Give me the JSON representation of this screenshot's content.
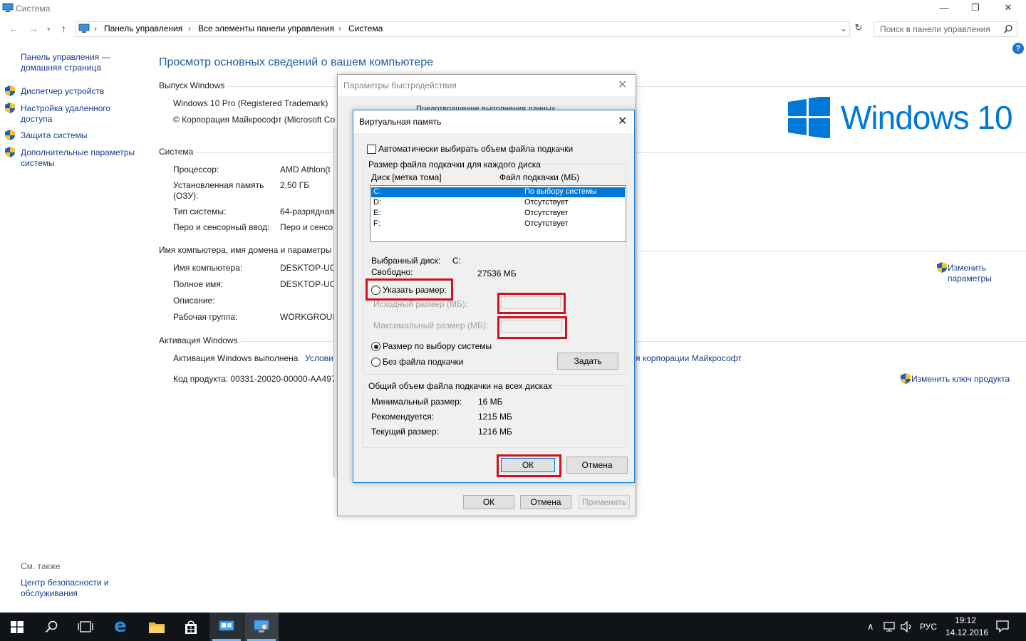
{
  "window": {
    "title": "Система",
    "controls": [
      "—",
      "❐",
      "✕"
    ]
  },
  "address_bar": {
    "crumbs": [
      "Панель управления",
      "Все элементы панели управления",
      "Система"
    ],
    "search_placeholder": "Поиск в панели управления"
  },
  "sidebar": {
    "home": [
      "Панель управления —",
      "домашняя страница"
    ],
    "items": [
      {
        "label": [
          "Диспетчер устройств"
        ]
      },
      {
        "label": [
          "Настройка удаленного",
          "доступа"
        ]
      },
      {
        "label": [
          "Защита системы"
        ]
      },
      {
        "label": [
          "Дополнительные параметры",
          "системы"
        ]
      }
    ],
    "see_also": "См. также",
    "see_also_link": [
      "Центр безопасности и",
      "обслуживания"
    ]
  },
  "main": {
    "heading": "Просмотр основных сведений о вашем компьютере",
    "edition_title": "Выпуск Windows",
    "edition_name": "Windows 10 Pro (Registered Trademark)",
    "copyright": "© Корпорация Майкрософт (Microsoft Co",
    "logo_text": "Windows 10",
    "system_title": "Система",
    "system_rows": [
      {
        "label": "Процессор:",
        "value": "AMD Athlon(t"
      },
      {
        "label": "Установленная память",
        "label2": "(ОЗУ):",
        "value": "2,50 ГБ"
      },
      {
        "label": "Тип системы:",
        "value": "64-разрядная"
      },
      {
        "label": "Перо и сенсорный ввод:",
        "value": "Перо и сенсо"
      }
    ],
    "computer_title": "Имя компьютера, имя домена и параметры",
    "computer_rows": [
      {
        "label": "Имя компьютера:",
        "value": "DESKTOP-UC7"
      },
      {
        "label": "Полное имя:",
        "value": "DESKTOP-UC7"
      },
      {
        "label": "Описание:",
        "value": ""
      },
      {
        "label": "Рабочая группа:",
        "value": "WORKGROUP"
      }
    ],
    "change_params": [
      "Изменить",
      "параметры"
    ],
    "activation_title": "Активация Windows",
    "activation_status": "Активация Windows выполнена",
    "activation_terms": "Услови",
    "activation_terms_tail": "я корпорации Майкрософт",
    "product_code": "Код продукта:  00331-20020-00000-AA497",
    "change_key": "Изменить ключ продукта"
  },
  "perf_dialog": {
    "title": "Параметры быстродействия",
    "tab_hint": "Предотвращение выполнения данных",
    "ok": "ОК",
    "cancel": "Отмена",
    "apply": "Применить"
  },
  "vm_dialog": {
    "title": "Виртуальная память",
    "auto_label": "Автоматически выбирать объем файла подкачки",
    "auto_checked": false,
    "group_title": "Размер файла подкачки для каждого диска",
    "col_disk": "Диск [метка тома]",
    "col_file": "Файл подкачки (МБ)",
    "drives": [
      {
        "disk": "C:",
        "size": "По выбору системы",
        "selected": true
      },
      {
        "disk": "D:",
        "size": "Отсутствует",
        "selected": false
      },
      {
        "disk": "E:",
        "size": "Отсутствует",
        "selected": false
      },
      {
        "disk": "F:",
        "size": "Отсутствует",
        "selected": false
      }
    ],
    "selected_disk_label": "Выбранный диск:",
    "selected_disk_value": "C:",
    "free_label": "Свободно:",
    "free_value": "27536 МБ",
    "custom_size": "Указать размер:",
    "initial_size": "Исходный размер (МБ):",
    "max_size": "Максимальный размер (МБ):",
    "system_managed": "Размер по выбору системы",
    "no_paging": "Без файла подкачки",
    "set_button": "Задать",
    "total_title": "Общий объем файла подкачки на всех дисках",
    "min_label": "Минимальный размер:",
    "min_value": "16 МБ",
    "rec_label": "Рекомендуется:",
    "rec_value": "1215 МБ",
    "cur_label": "Текущий размер:",
    "cur_value": "1216 МБ",
    "ok": "ОК",
    "cancel": "Отмена"
  },
  "taskbar": {
    "lang": "РУС",
    "time": "19:12",
    "date": "14.12.2016"
  },
  "colors": {
    "accent": "#0078d7",
    "link": "#1a3c8c",
    "highlight": "#d0121b",
    "taskbar": "#101418"
  }
}
